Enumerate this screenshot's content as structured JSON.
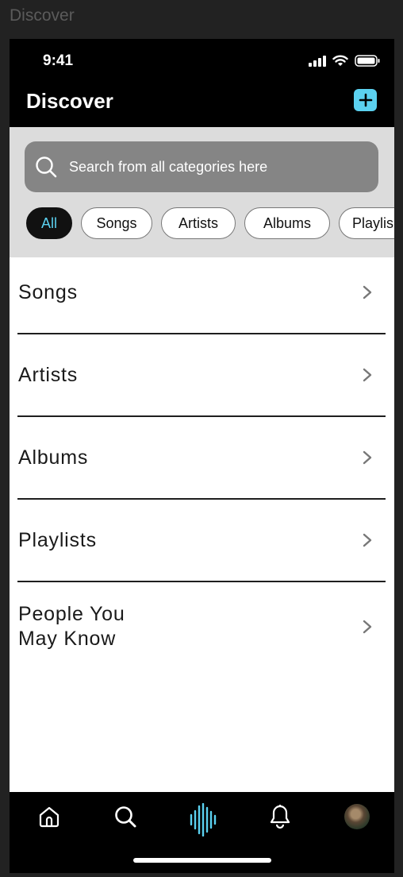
{
  "frame_label": "Discover",
  "status_bar": {
    "time": "9:41",
    "icons": [
      "signal-icon",
      "wifi-icon",
      "battery-icon"
    ]
  },
  "header": {
    "title": "Discover",
    "add_icon": "plus-icon",
    "accent_color": "#5bd1f0"
  },
  "search": {
    "placeholder": "Search from all categories here",
    "icon": "search-icon"
  },
  "filters": {
    "selected": "All",
    "chips": [
      "All",
      "Songs",
      "Artists",
      "Albums",
      "Playlis"
    ]
  },
  "categories": [
    {
      "label": "Songs"
    },
    {
      "label": "Artists"
    },
    {
      "label": "Albums"
    },
    {
      "label": "Playlists"
    },
    {
      "label_line1": "People You",
      "label_line2": "May Know"
    }
  ],
  "tab_bar": {
    "tabs": [
      "home-icon",
      "search-icon",
      "soundwave-icon",
      "bell-icon",
      "avatar"
    ],
    "active": "soundwave-icon"
  }
}
